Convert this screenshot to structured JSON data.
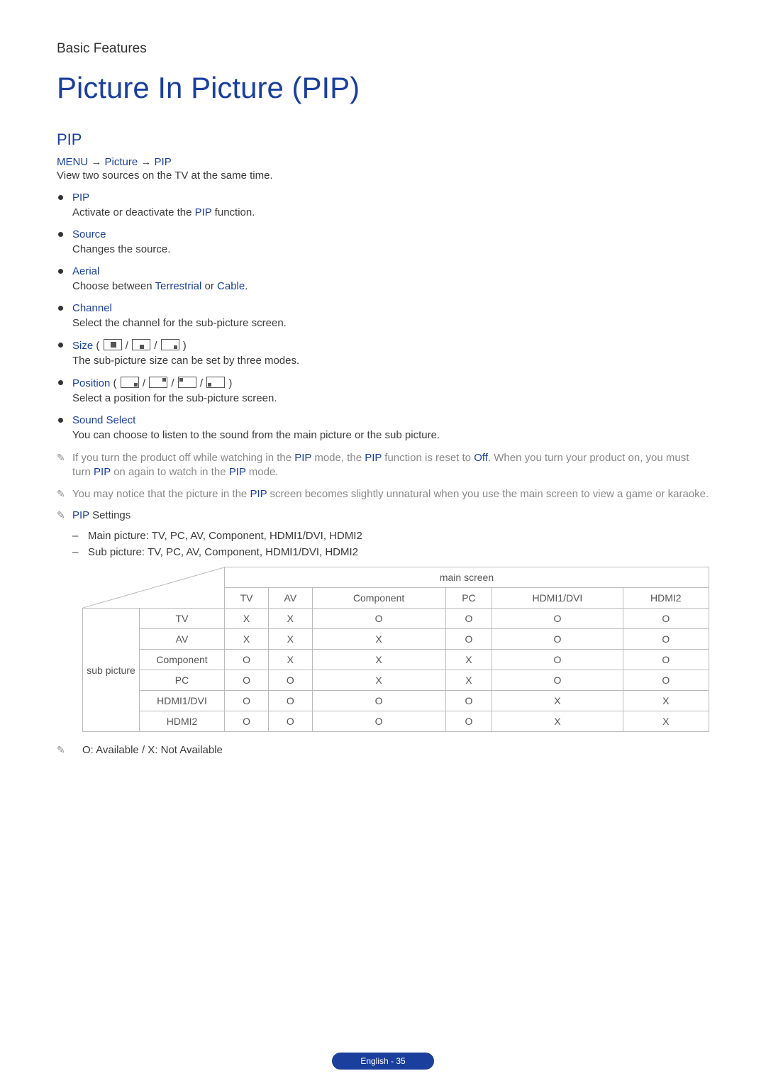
{
  "sectionTag": "Basic Features",
  "title": "Picture In Picture (PIP)",
  "subheading": "PIP",
  "menuPath": {
    "p1": "MENU",
    "p2": "Picture",
    "p3": "PIP"
  },
  "intro": "View two sources on the TV at the same time.",
  "options": [
    {
      "label": "PIP",
      "pre": "Activate or deactivate the ",
      "kw": "PIP",
      "post": " function."
    },
    {
      "label": "Source",
      "desc": "Changes the source."
    },
    {
      "label": "Aerial",
      "pre": "Choose between ",
      "kw": "Terrestrial",
      "mid": " or ",
      "kw2": "Cable",
      "post": "."
    },
    {
      "label": "Channel",
      "desc": "Select the channel for the sub-picture screen."
    },
    {
      "label": "Size",
      "desc": "The sub-picture size can be set by three modes."
    },
    {
      "label": "Position",
      "desc": "Select a position for the sub-picture screen."
    },
    {
      "label": "Sound Select",
      "desc": "You can choose to listen to the sound from the main picture or the sub picture."
    }
  ],
  "note1": {
    "a": "If you turn the product off while watching in the ",
    "kw1": "PIP",
    "b": " mode, the ",
    "kw2": "PIP",
    "c": " function is reset to ",
    "kw3": "Off",
    "d": ". When you turn your product on, you must turn ",
    "kw4": "PIP",
    "e": " on again to watch in the ",
    "kw5": "PIP",
    "f": " mode."
  },
  "note2": {
    "a": "You may notice that the picture in the ",
    "kw1": "PIP",
    "b": " screen becomes slightly unnatural when you use the main screen to view a game or karaoke."
  },
  "settingsHeader": {
    "kw": "PIP",
    "rest": " Settings"
  },
  "settingsLines": [
    "Main picture: TV, PC, AV, Component, HDMI1/DVI, HDMI2",
    "Sub picture: TV, PC, AV, Component, HDMI1/DVI, HDMI2"
  ],
  "table": {
    "mainHeader": "main screen",
    "subHeader": "sub picture",
    "cols": [
      "TV",
      "AV",
      "Component",
      "PC",
      "HDMI1/DVI",
      "HDMI2"
    ],
    "rows": [
      {
        "name": "TV",
        "cells": [
          "X",
          "X",
          "O",
          "O",
          "O",
          "O"
        ]
      },
      {
        "name": "AV",
        "cells": [
          "X",
          "X",
          "X",
          "O",
          "O",
          "O"
        ]
      },
      {
        "name": "Component",
        "cells": [
          "O",
          "X",
          "X",
          "X",
          "O",
          "O"
        ]
      },
      {
        "name": "PC",
        "cells": [
          "O",
          "O",
          "X",
          "X",
          "O",
          "O"
        ]
      },
      {
        "name": "HDMI1/DVI",
        "cells": [
          "O",
          "O",
          "O",
          "O",
          "X",
          "X"
        ]
      },
      {
        "name": "HDMI2",
        "cells": [
          "O",
          "O",
          "O",
          "O",
          "X",
          "X"
        ]
      }
    ]
  },
  "legend": "O: Available / X: Not Available",
  "footer": "English - 35"
}
